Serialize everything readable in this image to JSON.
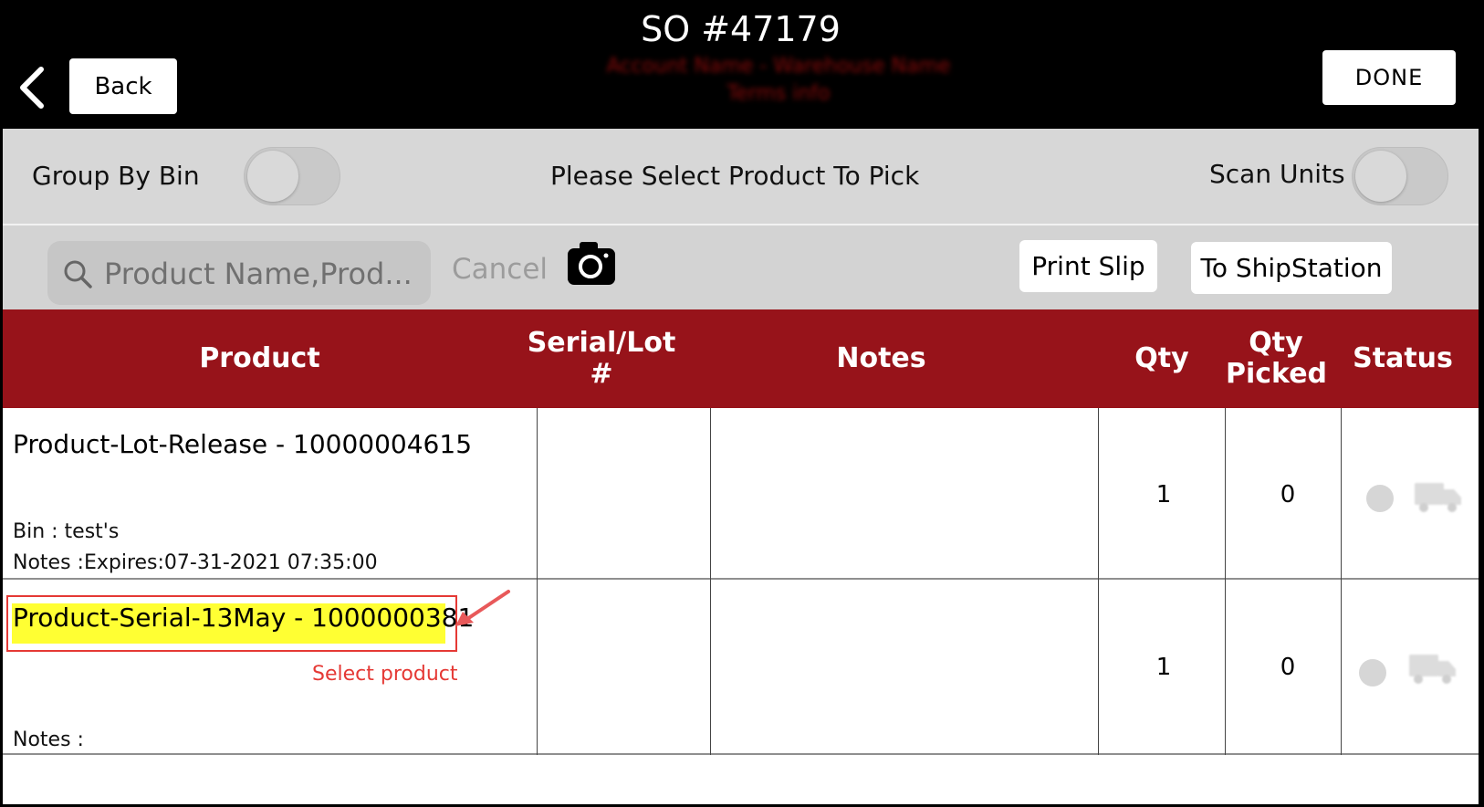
{
  "header": {
    "title": "SO #47179",
    "subtitle_line1": "Account Name - Warehouse Name",
    "subtitle_line2": "Terms info",
    "back_label": "Back",
    "done_label": "DONE"
  },
  "toolbar": {
    "group_by_bin_label": "Group By Bin",
    "group_by_bin_on": false,
    "instruction": "Please Select Product To Pick",
    "scan_units_label": "Scan Units",
    "scan_units_on": false
  },
  "search": {
    "placeholder": "Product Name,Prod...",
    "cancel_label": "Cancel",
    "print_slip_label": "Print Slip",
    "to_shipstation_label": "To ShipStation"
  },
  "table": {
    "columns": [
      "Product",
      "Serial/Lot #",
      "Notes",
      "Qty",
      "Qty Picked",
      "Status"
    ],
    "rows": [
      {
        "product": "Product-Lot-Release - 10000004615",
        "bin": "Bin : test's",
        "notes_line": "Notes :Expires:07-31-2021 07:35:00",
        "serial": "",
        "notes": "",
        "qty": "1",
        "qty_picked": "0"
      },
      {
        "product": "Product-Serial-13May - 1000000381",
        "bin": "",
        "notes_line": "Notes :",
        "serial": "",
        "notes": "",
        "qty": "1",
        "qty_picked": "0"
      }
    ]
  },
  "annotation": {
    "callout_text": "Select product",
    "highlight_color": "#ffff33",
    "box_color": "#e53935"
  },
  "colors": {
    "header_bg": "#000000",
    "table_header_bg": "#97131a",
    "toggle_row_bg": "#d7d7d7"
  }
}
